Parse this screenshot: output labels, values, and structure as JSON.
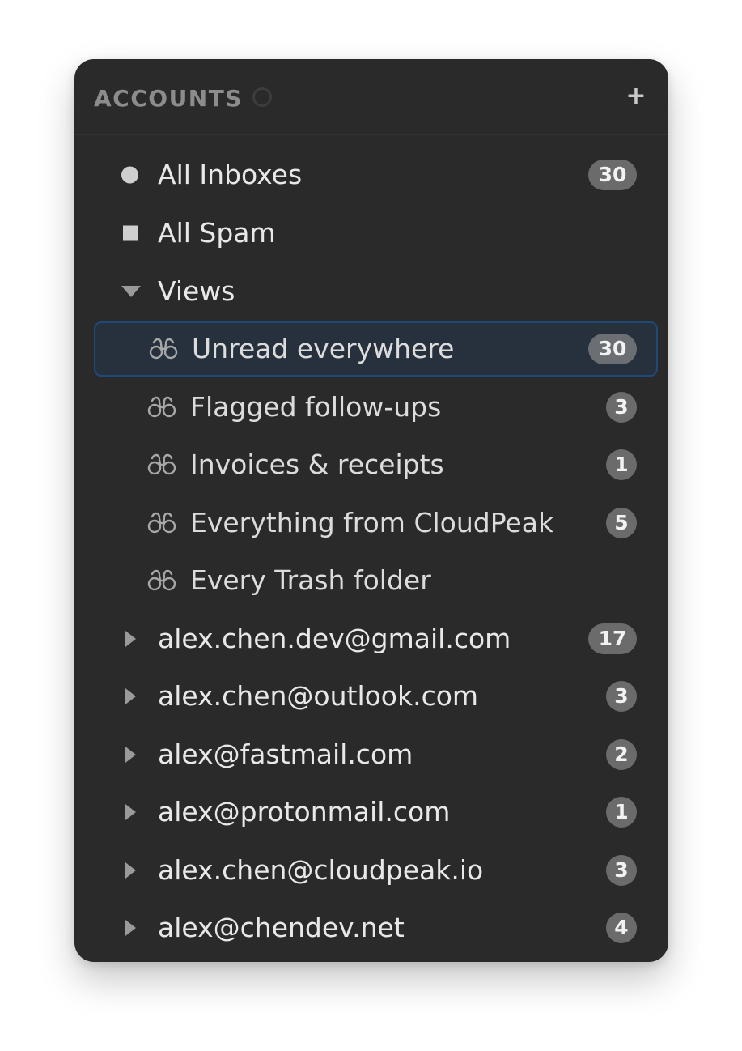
{
  "header": {
    "title": "ACCOUNTS",
    "add_label": "+"
  },
  "top_items": [
    {
      "label": "All Inboxes",
      "icon": "dot-icon",
      "count": "30"
    },
    {
      "label": "All Spam",
      "icon": "square-icon",
      "count": ""
    },
    {
      "label": "Views",
      "icon": "chevron-down-icon",
      "count": ""
    }
  ],
  "views": [
    {
      "label": "Unread everywhere",
      "icon": "binoculars-icon",
      "count": "30",
      "selected": true
    },
    {
      "label": "Flagged follow-ups",
      "icon": "binoculars-icon",
      "count": "3"
    },
    {
      "label": "Invoices & receipts",
      "icon": "binoculars-icon",
      "count": "1"
    },
    {
      "label": "Everything from CloudPeak",
      "icon": "binoculars-icon",
      "count": "5"
    },
    {
      "label": "Every Trash folder",
      "icon": "binoculars-icon",
      "count": ""
    }
  ],
  "accounts": [
    {
      "label": "alex.chen.dev@gmail.com",
      "icon": "chevron-right-icon",
      "count": "17"
    },
    {
      "label": "alex.chen@outlook.com",
      "icon": "chevron-right-icon",
      "count": "3"
    },
    {
      "label": "alex@fastmail.com",
      "icon": "chevron-right-icon",
      "count": "2"
    },
    {
      "label": "alex@protonmail.com",
      "icon": "chevron-right-icon",
      "count": "1"
    },
    {
      "label": "alex.chen@cloudpeak.io",
      "icon": "chevron-right-icon",
      "count": "3"
    },
    {
      "label": "alex@chendev.net",
      "icon": "chevron-right-icon",
      "count": "4"
    }
  ],
  "colors": {
    "panel_bg": "#2a2a2a",
    "selected_bg": "#26313d",
    "selected_border": "#1f4a78",
    "badge_bg": "#6b6b6b",
    "text": "#e8e8e8",
    "header_text": "#8c8c8c"
  }
}
